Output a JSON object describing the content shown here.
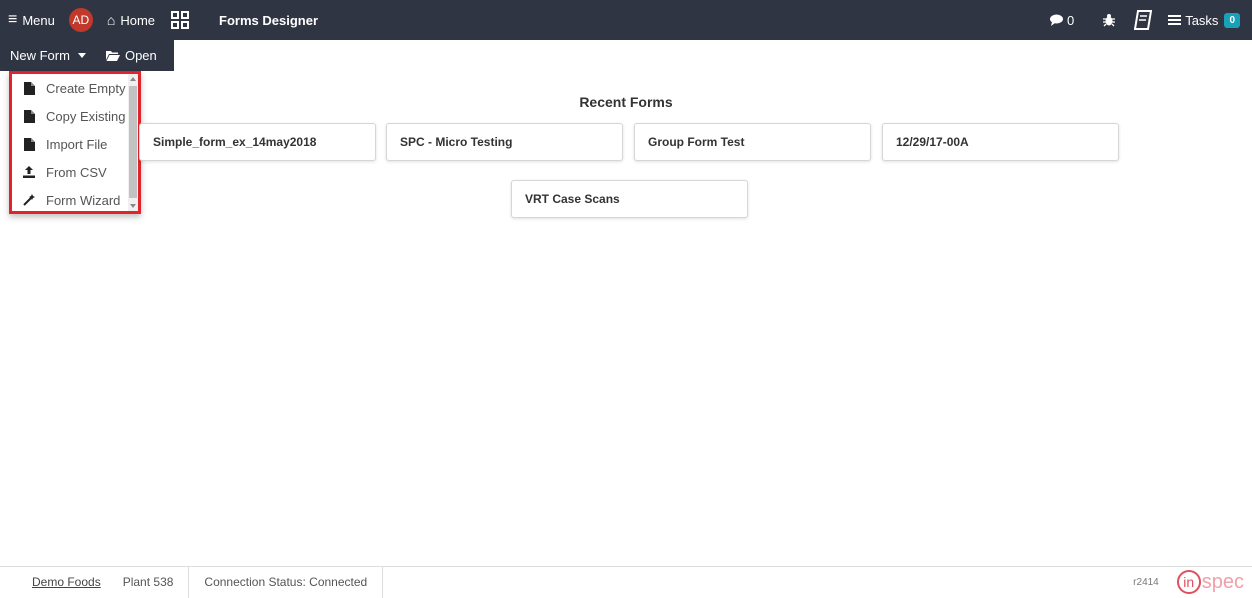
{
  "topbar": {
    "menu_label": "Menu",
    "menu_icon": "≡",
    "avatar": "AD",
    "home_label": "Home",
    "home_icon": "⌂",
    "title": "Forms Designer",
    "chat_count": "0",
    "tasks_label": "Tasks",
    "tasks_count": "0"
  },
  "toolbar": {
    "new_form_label": "New Form",
    "open_label": "Open"
  },
  "dropdown": {
    "items": [
      {
        "label": "Create Empty",
        "icon": "file-icon"
      },
      {
        "label": "Copy Existing",
        "icon": "file-icon"
      },
      {
        "label": "Import File",
        "icon": "file-icon"
      },
      {
        "label": "From CSV",
        "icon": "upload-icon"
      },
      {
        "label": "Form Wizard",
        "icon": "wand-icon"
      }
    ]
  },
  "recent": {
    "title": "Recent Forms",
    "forms": [
      "Simple_form_ex_14may2018",
      "SPC - Micro Testing",
      "Group Form Test",
      "12/29/17-00A",
      "VRT Case Scans"
    ]
  },
  "footer": {
    "company": "Demo Foods",
    "plant": "Plant 538",
    "connection": "Connection Status: Connected",
    "revision": "r2414",
    "logo_in": "in",
    "logo_spec": "spec"
  },
  "colors": {
    "topbar_bg": "#2f3542",
    "highlight_border": "#e0242d",
    "avatar_bg": "#c0392b",
    "tasks_badge": "#17a2b8"
  }
}
